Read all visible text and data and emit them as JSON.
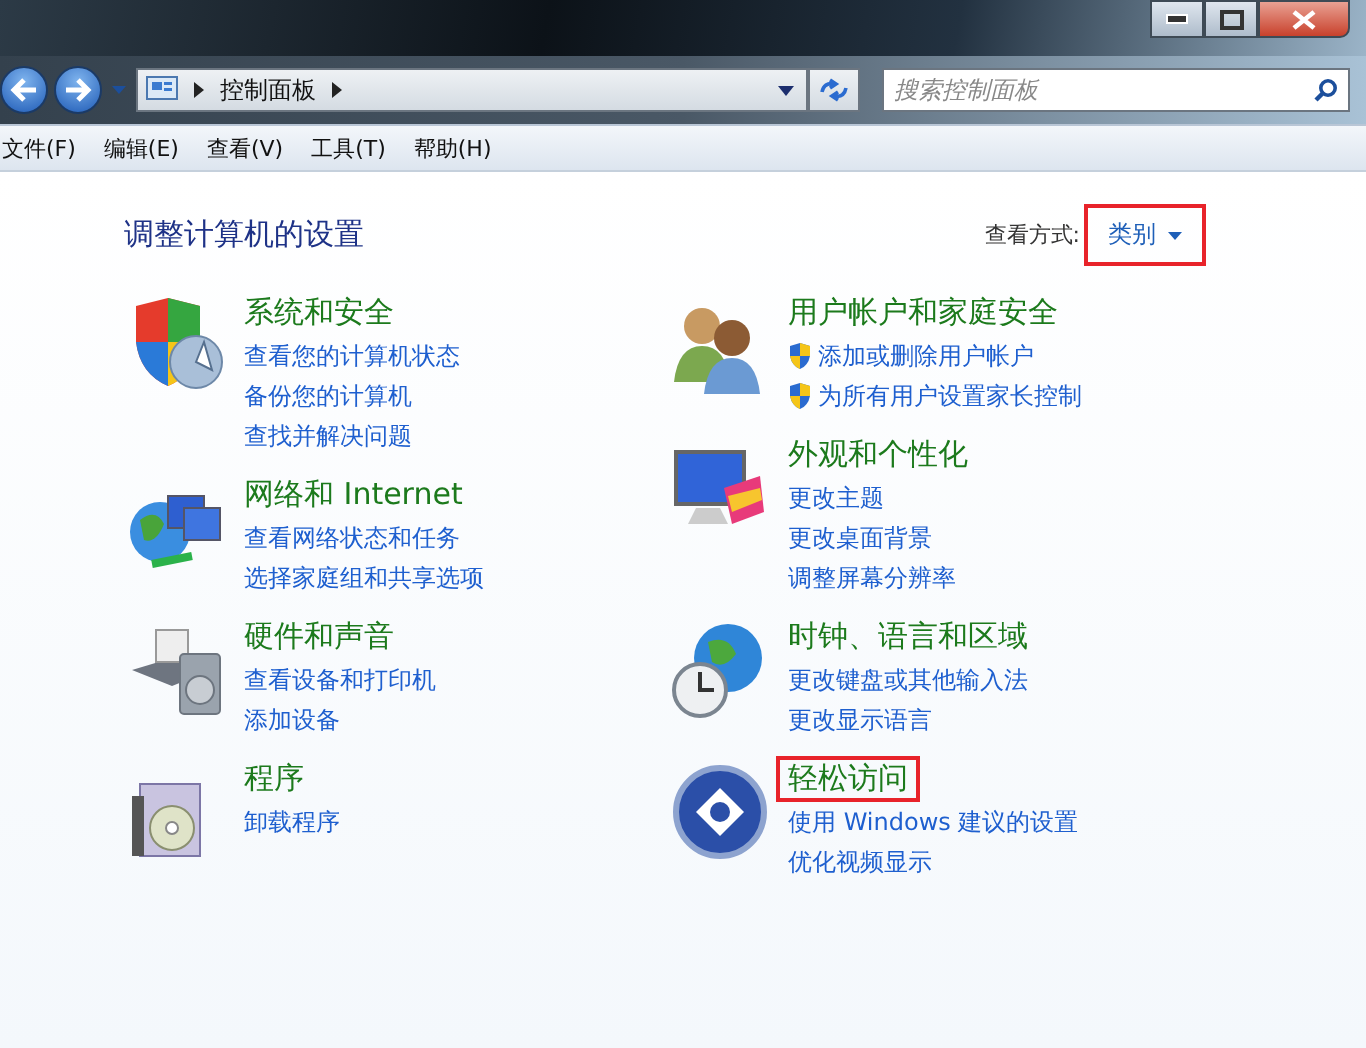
{
  "address_bar": {
    "path": [
      "控制面板"
    ]
  },
  "search": {
    "placeholder": "搜索控制面板"
  },
  "menu": [
    "文件(F)",
    "编辑(E)",
    "查看(V)",
    "工具(T)",
    "帮助(H)"
  ],
  "heading": "调整计算机的设置",
  "view_by": {
    "label": "查看方式:",
    "value": "类别",
    "highlighted": true
  },
  "categories": [
    {
      "title": "系统和安全",
      "highlighted": false,
      "links": [
        {
          "text": "查看您的计算机状态",
          "kind": "plain"
        },
        {
          "text": "备份您的计算机",
          "kind": "plain"
        },
        {
          "text": "查找并解决问题",
          "kind": "plain"
        }
      ]
    },
    {
      "title": "网络和 Internet",
      "highlighted": false,
      "links": [
        {
          "text": "查看网络状态和任务",
          "kind": "plain"
        },
        {
          "text": "选择家庭组和共享选项",
          "kind": "plain"
        }
      ]
    },
    {
      "title": "硬件和声音",
      "highlighted": false,
      "links": [
        {
          "text": "查看设备和打印机",
          "kind": "plain"
        },
        {
          "text": "添加设备",
          "kind": "plain"
        }
      ]
    },
    {
      "title": "程序",
      "highlighted": false,
      "links": [
        {
          "text": "卸载程序",
          "kind": "plain"
        }
      ]
    },
    {
      "title": "用户帐户和家庭安全",
      "highlighted": false,
      "links": [
        {
          "text": "添加或删除用户帐户",
          "kind": "shield"
        },
        {
          "text": "为所有用户设置家长控制",
          "kind": "shield"
        }
      ]
    },
    {
      "title": "外观和个性化",
      "highlighted": false,
      "links": [
        {
          "text": "更改主题",
          "kind": "plain"
        },
        {
          "text": "更改桌面背景",
          "kind": "plain"
        },
        {
          "text": "调整屏幕分辨率",
          "kind": "plain"
        }
      ]
    },
    {
      "title": "时钟、语言和区域",
      "highlighted": false,
      "links": [
        {
          "text": "更改键盘或其他输入法",
          "kind": "plain"
        },
        {
          "text": "更改显示语言",
          "kind": "plain"
        }
      ]
    },
    {
      "title": "轻松访问",
      "highlighted": true,
      "links": [
        {
          "text": "使用 Windows 建议的设置",
          "kind": "plain"
        },
        {
          "text": "优化视频显示",
          "kind": "plain"
        }
      ]
    }
  ]
}
